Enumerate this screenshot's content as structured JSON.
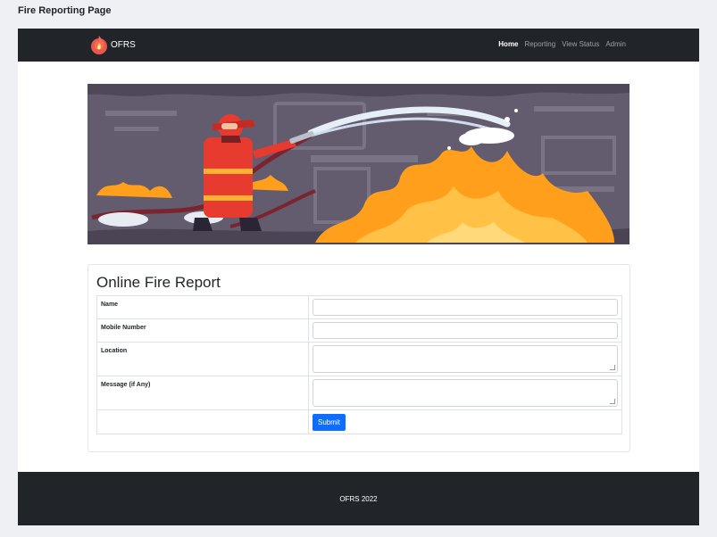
{
  "page_caption": "Fire Reporting Page",
  "navbar": {
    "brand": "OFRS",
    "links": [
      "Home",
      "Reporting",
      "View Status",
      "Admin"
    ],
    "active": "Home"
  },
  "form": {
    "title": "Online Fire Report",
    "fields": [
      {
        "label": "Name",
        "type": "text",
        "value": ""
      },
      {
        "label": "Mobile Number",
        "type": "text",
        "value": ""
      },
      {
        "label": "Location",
        "type": "textarea",
        "value": ""
      },
      {
        "label": "Message (if Any)",
        "type": "textarea",
        "value": ""
      }
    ],
    "submit_label": "Submit"
  },
  "footer": {
    "text": "OFRS 2022"
  },
  "colors": {
    "navbar_bg": "#212529",
    "primary": "#0d6efd",
    "flame": "#ff9f1c",
    "firefighter": "#e63b2e"
  },
  "icons": {
    "brand_logo": "fire-logo-icon",
    "banner": "firefighter-illustration"
  }
}
